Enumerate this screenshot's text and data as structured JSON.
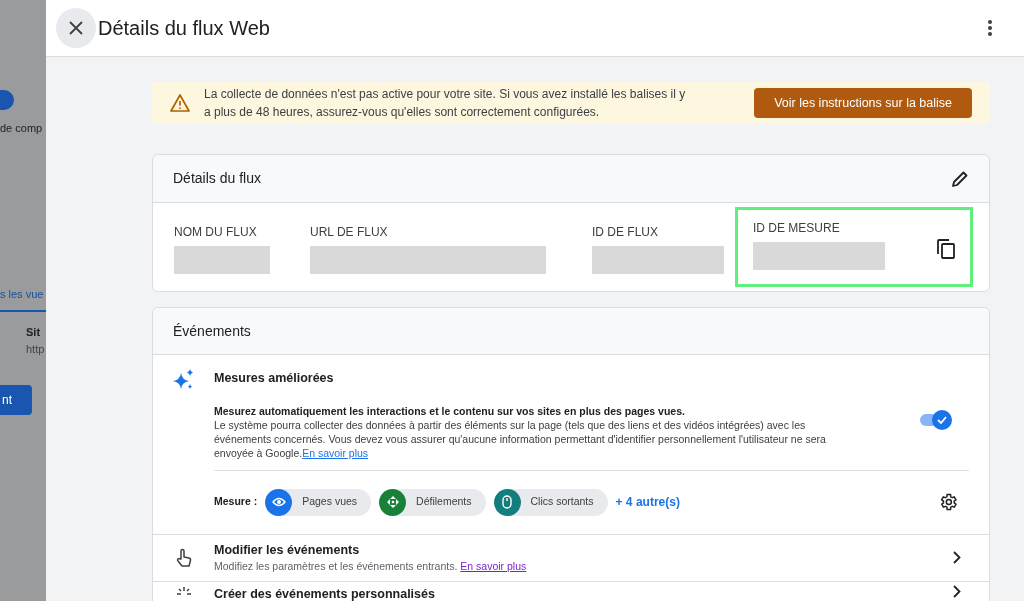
{
  "background_page": {
    "texts": [
      "de comp",
      "s les vue",
      "Sit",
      "http"
    ],
    "button": "nt"
  },
  "panel": {
    "title": "Détails du flux Web"
  },
  "banner": {
    "message": "La collecte de données n'est pas active pour votre site. Si vous avez installé les balises il y a plus de 48 heures, assurez-vous qu'elles sont correctement configurées.",
    "button": "Voir les instructions sur la balise"
  },
  "stream_details": {
    "title": "Détails du flux",
    "fields": [
      {
        "label": "NOM DU FLUX",
        "highlighted": false,
        "copyable": false
      },
      {
        "label": "URL DE FLUX",
        "highlighted": false,
        "copyable": false
      },
      {
        "label": "ID DE FLUX",
        "highlighted": false,
        "copyable": false
      },
      {
        "label": "ID DE MESURE",
        "highlighted": true,
        "copyable": true
      }
    ]
  },
  "events": {
    "title": "Événements",
    "enhanced": {
      "title": "Mesures améliorées",
      "lead": "Mesurez automatiquement les interactions et le contenu sur vos sites en plus des pages vues.",
      "body": "Le système pourra collecter des données à partir des éléments sur la page (tels que des liens et des vidéos intégrées) avec les événements concernés. Vous devez vous assurer qu'aucune information permettant d'identifier personnellement l'utilisateur ne sera envoyée à Google.",
      "link": "En savoir plus",
      "on": true,
      "measure_label": "Mesure :",
      "chips": [
        {
          "label": "Pages vues",
          "kind": "eye",
          "color": "#1a73e8"
        },
        {
          "label": "Défilements",
          "kind": "scroll",
          "color": "#188038"
        },
        {
          "label": "Clics sortants",
          "kind": "mouse",
          "color": "#137e7e"
        }
      ],
      "more": "+ 4 autre(s)"
    },
    "rows": [
      {
        "title": "Modifier les événements",
        "subtitle": "Modifiez les paramètres et les événements entrants.",
        "link": "En savoir plus",
        "kind": "edit"
      },
      {
        "title": "Créer des événements personnalisés",
        "kind": "create"
      }
    ]
  }
}
